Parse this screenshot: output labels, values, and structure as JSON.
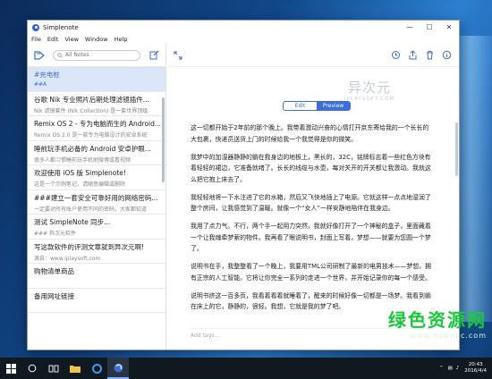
{
  "window": {
    "title": "Simplenote"
  },
  "menu": [
    "File",
    "Edit",
    "View",
    "Window",
    "Help"
  ],
  "sidebar": {
    "search_placeholder": "All Notes"
  },
  "notes": [
    {
      "title": "#充电桩",
      "preview": "##A",
      "selected": true
    },
    {
      "title": "谷歌 Nik 专业照片后期处理滤镜插件...",
      "preview": "Nik 滤镜套件 (Nik Collection) 是一套世界顶级",
      "selected": false
    },
    {
      "title": "Remix OS 2 - 专为电脑而生的 Android...",
      "preview": "Remix OS 2.0 是一款专为电脑设计的安卓系统",
      "selected": false
    },
    {
      "title": "睡前玩手机必备的 Android 安卓护眼...",
      "preview": "很多人都习惯睡前玩手机刷微博或看视频",
      "selected": false
    },
    {
      "title": "欢迎使用 iOS 版 Simplenote!",
      "preview": "这是一个示例笔记，请随意编辑或删除",
      "selected": false
    },
    {
      "title": "###建立一套安全可靠好用的网络密码...",
      "preview": "一定要对所有账户使用不同的密码，大家都知道",
      "selected": false
    },
    {
      "title": "测试 SimpleNote 同步...",
      "preview": "### 异次元软件",
      "selected": false
    },
    {
      "title": "写这款软件的评测文章就到异次元啊!",
      "preview": "源自：www.iplaysoft.com",
      "selected": false
    },
    {
      "title": "购物清单商品",
      "preview": "",
      "selected": false
    },
    {
      "title": "备用网址链接",
      "preview": "",
      "selected": false
    }
  ],
  "editor": {
    "edit_label": "Edit",
    "preview_label": "Preview",
    "add_tags_placeholder": "Add tags...",
    "paragraphs": [
      "这一切都开始于2年前的那个晚上。我带着激动兴奋的心情打开京东寄给我的一个长长的大包裹，快递员送货上门的时候给我一个我觉得是你的微笑。",
      "我梦中的加湿器静静的躺在我身边的地板上，黑长的，32C，铭牌标志着一些红色方块有着轻轻的裙边，它准备就绪了。长长的线缆与水壶，每对关开的开关都让我激动。我就这么把它抱上床去了。",
      "我轻轻地将一下水注进了它的水箱，然后又飞快地插上了电源。它就这样一点点地湿润了整个房间，让我感觉到了温暖。就像一个“女人”一样安静地陪伴在我身边。",
      "我用了点力气。不行，两个手一起用力突然，我就好像打开了一个神秘的盒子，里面藏着一个让我魂牵梦萦的物件。我再看了眼说明书，封面上写着，梦想——就要为您圆一个梦了。",
      "说明书在手，我整整看了一个晚上，我要用TML公司研制了最新的电男技术——梦想，拥有正宗的人工智能。它将让你完全一系列的走进一个世界，并开始记录你的每一个感受。",
      "说明书挤这一百多页，我看着看着就睡着了，醒来的时候好像一切都是一场梦。我看到躺在床上的它，静静的，很轻。我想，它就是我的梦了吧。"
    ]
  },
  "watermark": {
    "main": "异次元",
    "sub": "IPLAYSOFT.COM"
  },
  "green_watermark": {
    "main": "绿色资源网",
    "sub": "www.downcc.com"
  },
  "taskbar": {
    "time": "20:43",
    "date": "2016/4/4"
  }
}
